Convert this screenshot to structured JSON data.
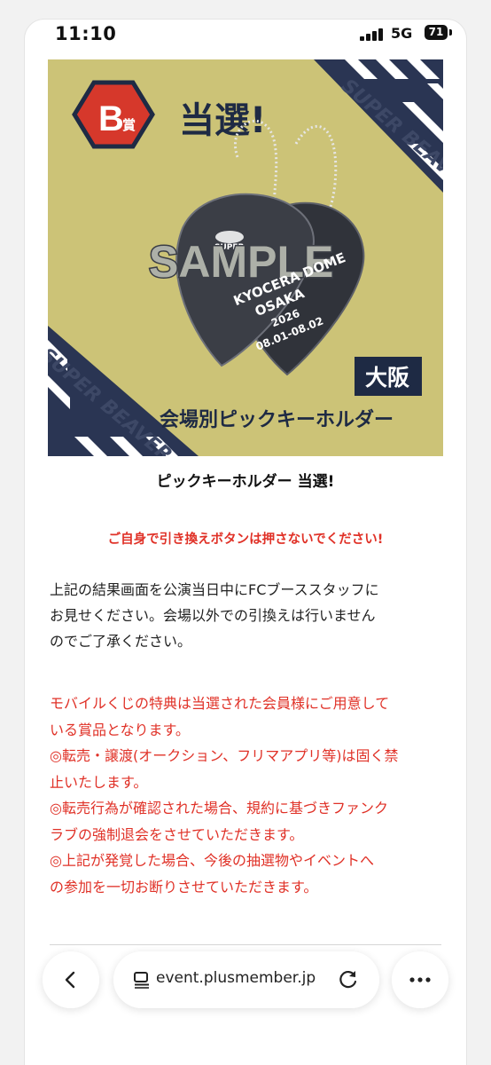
{
  "status_bar": {
    "time": "11:10",
    "network": "5G",
    "battery": "71"
  },
  "banner": {
    "badge_letter": "B",
    "badge_suffix": "賞",
    "headline": "当選!",
    "sample_watermark": "SAMPLE",
    "pick_text_1": "KYOCERA DOME",
    "pick_text_2": "OSAKA",
    "pick_text_3": "2026",
    "pick_text_4": "08.01-08.02",
    "city_label": "大阪",
    "product_label": "会場別ピックキーホルダー",
    "stripe_text": "SUPER BEAVER SUPER BEAVER"
  },
  "caption": "ピックキーホルダー 当選!",
  "warning": "ご自身で引き換えボタンは押さないでください!",
  "body_lines": [
    "上記の結果画面を公演当日中にFCブーススタッフに",
    "お見せください。会場以外での引換えは行いません",
    "のでご了承ください。"
  ],
  "notice_lines": [
    "モバイルくじの特典は当選された会員様にご用意して",
    "いる賞品となります。",
    "◎転売・譲渡(オークション、フリマアプリ等)は固く禁",
    "止いたします。",
    "◎転売行為が確認された場合、規約に基づきファンク",
    "ラブの強制退会をさせていただきます。",
    "◎上記が発覚した場合、今後の抽選物やイベントへ",
    "の参加を一切お断りさせていただきます。"
  ],
  "toolbar": {
    "url": "event.plusmember.jp"
  },
  "colors": {
    "banner_bg": "#ccc377",
    "navy": "#2a3553",
    "accent_red": "#e03127",
    "badge_red": "#d6382b"
  }
}
